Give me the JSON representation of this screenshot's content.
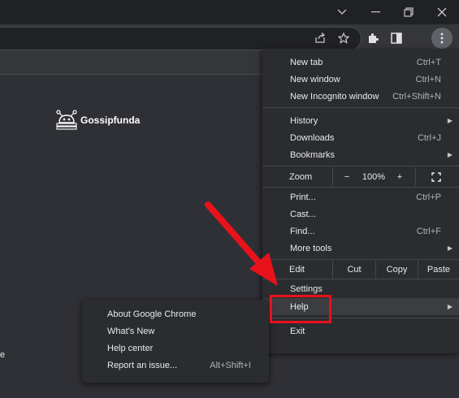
{
  "window": {
    "controls": [
      "chevron-down",
      "minimize",
      "restore",
      "close"
    ]
  },
  "logo": {
    "text": "Gossipfunda"
  },
  "page": {
    "edge_text": "e"
  },
  "menu": {
    "items": [
      {
        "label": "New tab",
        "shortcut": "Ctrl+T"
      },
      {
        "label": "New window",
        "shortcut": "Ctrl+N"
      },
      {
        "label": "New Incognito window",
        "shortcut": "Ctrl+Shift+N"
      },
      {
        "label": "History",
        "shortcut": ""
      },
      {
        "label": "Downloads",
        "shortcut": "Ctrl+J"
      },
      {
        "label": "Bookmarks",
        "shortcut": ""
      },
      {
        "label": "Print...",
        "shortcut": "Ctrl+P"
      },
      {
        "label": "Cast...",
        "shortcut": ""
      },
      {
        "label": "Find...",
        "shortcut": "Ctrl+F"
      },
      {
        "label": "More tools",
        "shortcut": ""
      },
      {
        "label": "Settings",
        "shortcut": ""
      },
      {
        "label": "Help",
        "shortcut": ""
      },
      {
        "label": "Exit",
        "shortcut": ""
      }
    ],
    "zoom": {
      "label": "Zoom",
      "minus": "−",
      "value": "100%",
      "plus": "+"
    },
    "edit": {
      "label": "Edit",
      "cut": "Cut",
      "copy": "Copy",
      "paste": "Paste"
    }
  },
  "help_submenu": {
    "items": [
      {
        "label": "About Google Chrome",
        "shortcut": ""
      },
      {
        "label": "What's New",
        "shortcut": ""
      },
      {
        "label": "Help center",
        "shortcut": ""
      },
      {
        "label": "Report an issue...",
        "shortcut": "Alt+Shift+I"
      }
    ]
  },
  "annotation": {
    "highlight_color": "#e8121b",
    "arrow_color": "#e8121b"
  }
}
